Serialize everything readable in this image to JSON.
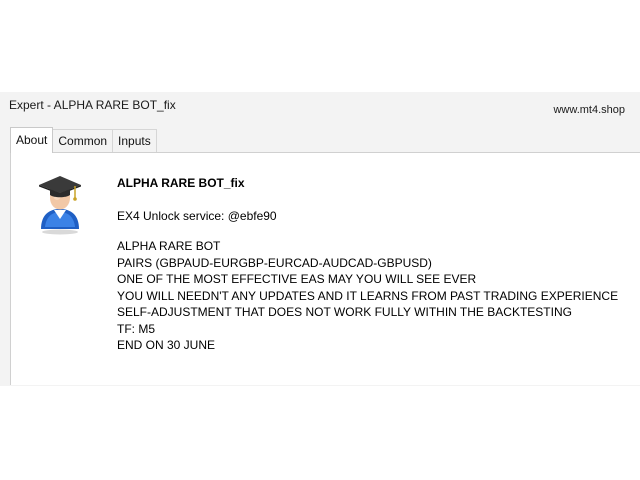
{
  "window": {
    "title": "Expert - ALPHA RARE BOT_fix",
    "watermark": "www.mt4.shop"
  },
  "tabs": [
    {
      "label": "About",
      "active": true
    },
    {
      "label": "Common",
      "active": false
    },
    {
      "label": "Inputs",
      "active": false
    }
  ],
  "about": {
    "icon": "graduate-user-icon",
    "ea_name": "ALPHA RARE BOT_fix",
    "unlock_text": "EX4 Unlock service: @ebfe90",
    "description": [
      "ALPHA RARE BOT",
      "PAIRS (GBPAUD-EURGBP-EURCAD-AUDCAD-GBPUSD)",
      "ONE OF THE MOST EFFECTIVE EAS MAY YOU WILL SEE EVER",
      "YOU WILL NEEDN'T ANY UPDATES AND IT LEARNS FROM PAST TRADING EXPERIENCE",
      "SELF-ADJUSTMENT THAT DOES NOT WORK FULLY WITHIN THE BACKTESTING",
      "TF: M5",
      "END ON 30 JUNE"
    ]
  },
  "colors": {
    "window_bg": "#f3f3f3",
    "panel_bg": "#ffffff",
    "avatar_blue": "#1f5fc4",
    "cap_dark": "#3a3a3a"
  }
}
